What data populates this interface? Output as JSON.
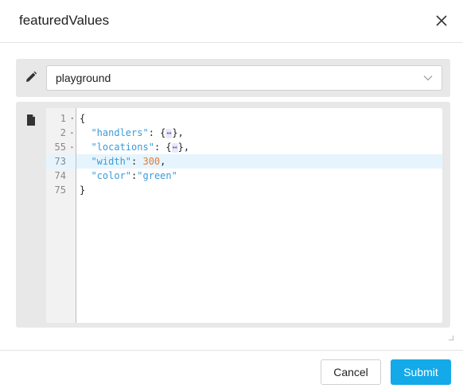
{
  "dialog": {
    "title": "featuredValues",
    "close_icon": "close-icon"
  },
  "selector": {
    "icon": "pencil-icon",
    "value": "playground",
    "chevron_icon": "chevron-down-icon"
  },
  "editor": {
    "icon": "file-icon",
    "lines": [
      {
        "num": "1",
        "fold": "▾"
      },
      {
        "num": "2",
        "fold": "▸"
      },
      {
        "num": "55",
        "fold": "▸"
      },
      {
        "num": "73",
        "fold": ""
      },
      {
        "num": "74",
        "fold": ""
      },
      {
        "num": "75",
        "fold": ""
      }
    ],
    "tokens": {
      "open_brace": "{",
      "handlers_key": "\"handlers\"",
      "locations_key": "\"locations\"",
      "width_key": "\"width\"",
      "width_value": "300",
      "color_key": "\"color\"",
      "color_value": "\"green\"",
      "fold_placeholder": "↔",
      "close_brace": "}"
    },
    "active_line": "73"
  },
  "footer": {
    "cancel_label": "Cancel",
    "submit_label": "Submit",
    "submit_color": "#14a9e8"
  }
}
